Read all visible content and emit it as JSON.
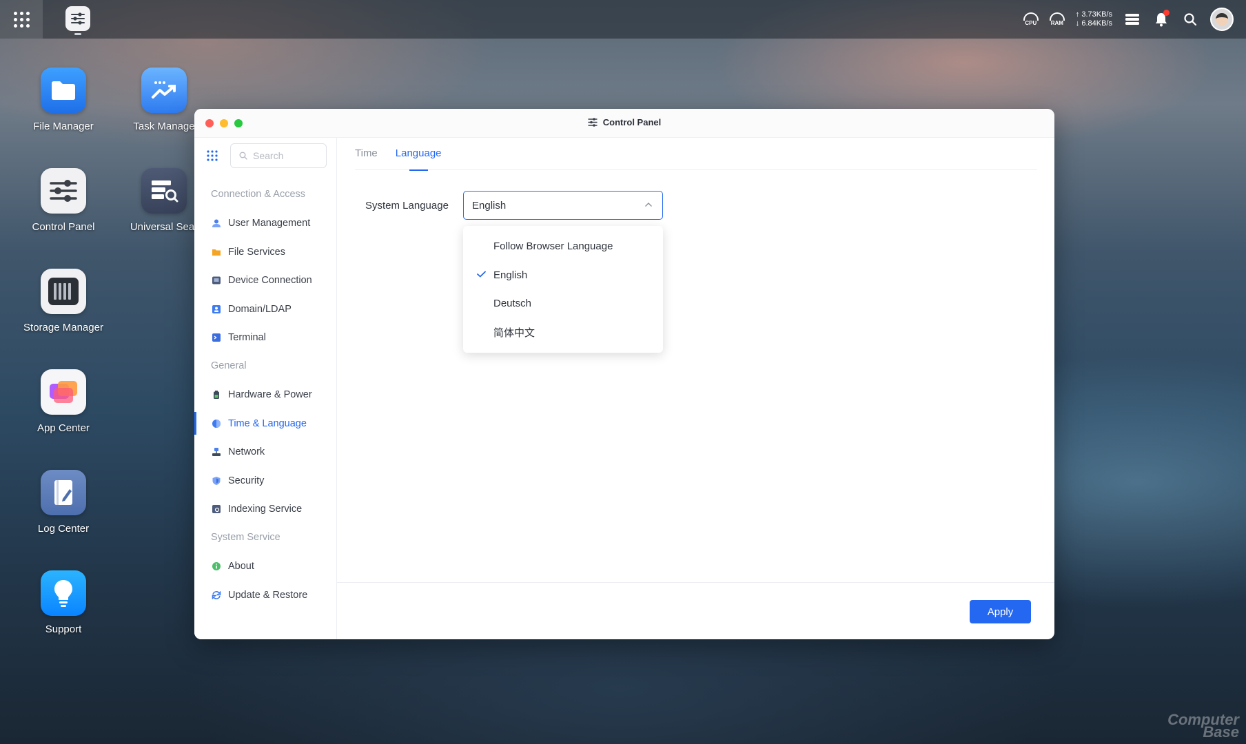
{
  "taskbar": {
    "cpu_label": "CPU",
    "ram_label": "RAM",
    "upload_speed": "↑ 3.73KB/s",
    "download_speed": "↓ 6.84KB/s"
  },
  "desktop": {
    "icons": [
      {
        "label": "File Manager"
      },
      {
        "label": "Task Manage"
      },
      {
        "label": "Control Panel"
      },
      {
        "label": "Universal Sear"
      },
      {
        "label": "Storage Manager"
      },
      {
        "label": "App Center"
      },
      {
        "label": "Log Center"
      },
      {
        "label": "Support"
      }
    ]
  },
  "window": {
    "title": "Control Panel"
  },
  "sidebar": {
    "search_placeholder": "Search",
    "sections": [
      {
        "title": "Connection & Access",
        "items": [
          {
            "label": "User Management"
          },
          {
            "label": "File Services"
          },
          {
            "label": "Device Connection"
          },
          {
            "label": "Domain/LDAP"
          },
          {
            "label": "Terminal"
          }
        ]
      },
      {
        "title": "General",
        "items": [
          {
            "label": "Hardware & Power"
          },
          {
            "label": "Time & Language"
          },
          {
            "label": "Network"
          },
          {
            "label": "Security"
          },
          {
            "label": "Indexing Service"
          }
        ]
      },
      {
        "title": "System Service",
        "items": [
          {
            "label": "About"
          },
          {
            "label": "Update & Restore"
          }
        ]
      }
    ],
    "active_item": "Time & Language"
  },
  "main": {
    "tabs": [
      {
        "label": "Time"
      },
      {
        "label": "Language"
      }
    ],
    "active_tab": "Language",
    "system_language": {
      "label": "System Language",
      "selected": "English",
      "options": [
        {
          "label": "Follow Browser Language"
        },
        {
          "label": "English"
        },
        {
          "label": "Deutsch"
        },
        {
          "label": "简体中文"
        }
      ]
    },
    "apply_label": "Apply"
  },
  "watermark": {
    "line1": "Computer",
    "line2": "Base"
  },
  "colors": {
    "accent": "#2468f2",
    "close": "#ff5f57",
    "minimize": "#febc2e",
    "maximize": "#28c840"
  }
}
